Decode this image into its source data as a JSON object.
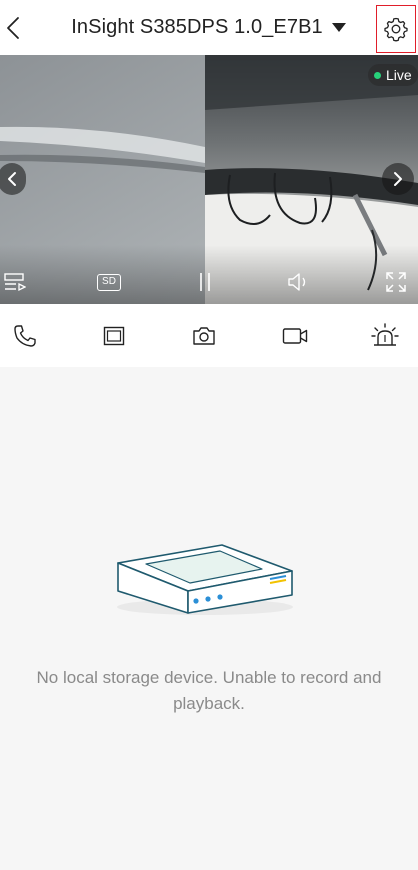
{
  "header": {
    "title": "InSight S385DPS 1.0_E7B1",
    "back_icon": "chevron-left-icon",
    "dropdown_icon": "caret-down-icon",
    "settings_icon": "gear-icon",
    "settings_highlight_color": "#e01e2a"
  },
  "video": {
    "live_label": "Live",
    "live_color": "#27d27a",
    "quality_label": "SD",
    "prev_icon": "chevron-left-icon",
    "next_icon": "chevron-right-icon",
    "controls": [
      "playlist-icon",
      "sd-quality-icon",
      "pause-icon",
      "volume-icon",
      "fullscreen-icon"
    ]
  },
  "toolbar": {
    "items": [
      "phone-icon",
      "split-screen-icon",
      "camera-icon",
      "video-record-icon",
      "alarm-siren-icon"
    ]
  },
  "empty_state": {
    "illustration": "storage-device-illustration",
    "message": "No local storage device. Unable to record and playback."
  }
}
